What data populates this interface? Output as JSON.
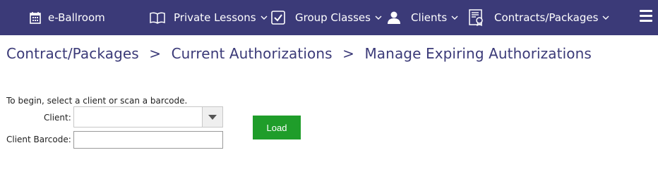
{
  "nav": {
    "brand": {
      "label": "e-Ballroom",
      "icon": "calendar-icon"
    },
    "items": [
      {
        "label": "Private Lessons",
        "icon": "book-icon"
      },
      {
        "label": "Group Classes",
        "icon": "checkbox-icon"
      },
      {
        "label": "Clients",
        "icon": "user-icon"
      },
      {
        "label": "Contracts/Packages",
        "icon": "certificate-icon"
      }
    ],
    "menu_icon": "hamburger-icon"
  },
  "breadcrumb": {
    "items": [
      "Contract/Packages",
      "Current Authorizations",
      "Manage Expiring Authorizations"
    ],
    "separator": ">"
  },
  "form": {
    "intro": "To begin, select a client or scan a barcode.",
    "client_label": "Client:",
    "client_value": "",
    "barcode_label": "Client Barcode:",
    "barcode_value": "",
    "load_label": "Load"
  },
  "colors": {
    "nav_bg": "#3b3a78",
    "breadcrumb": "#3b3a78",
    "load_button": "#1f9d2a"
  }
}
